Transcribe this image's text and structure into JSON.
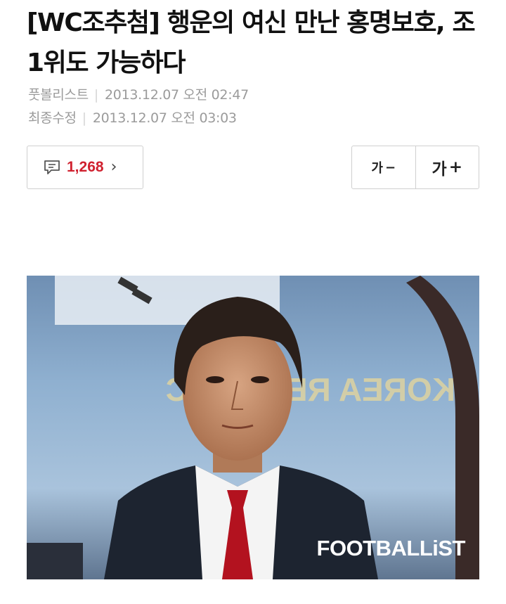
{
  "article": {
    "headline": "[WC조추첨] 행운의 여신 만난 홍명보호, 조 1위도 가능하다",
    "source": "풋볼리스트",
    "published": "2013.12.07 오전 02:47",
    "updated_label": "최종수정",
    "updated": "2013.12.07 오전 03:03"
  },
  "toolbar": {
    "comment_count": "1,268",
    "font_decrease_label": "가",
    "font_decrease_op": "−",
    "font_increase_label": "가",
    "font_increase_op": "+"
  },
  "photo": {
    "watermark": "FOOTBALLiST",
    "background_text": "KOREA REPUBLIC"
  },
  "colors": {
    "comment_count": "#d0212f",
    "meta_text": "#9b9b9b",
    "border": "#cfcfcf"
  },
  "icons": {
    "comment": "speech-bubble-icon",
    "chevron": "chevron-right-icon"
  }
}
